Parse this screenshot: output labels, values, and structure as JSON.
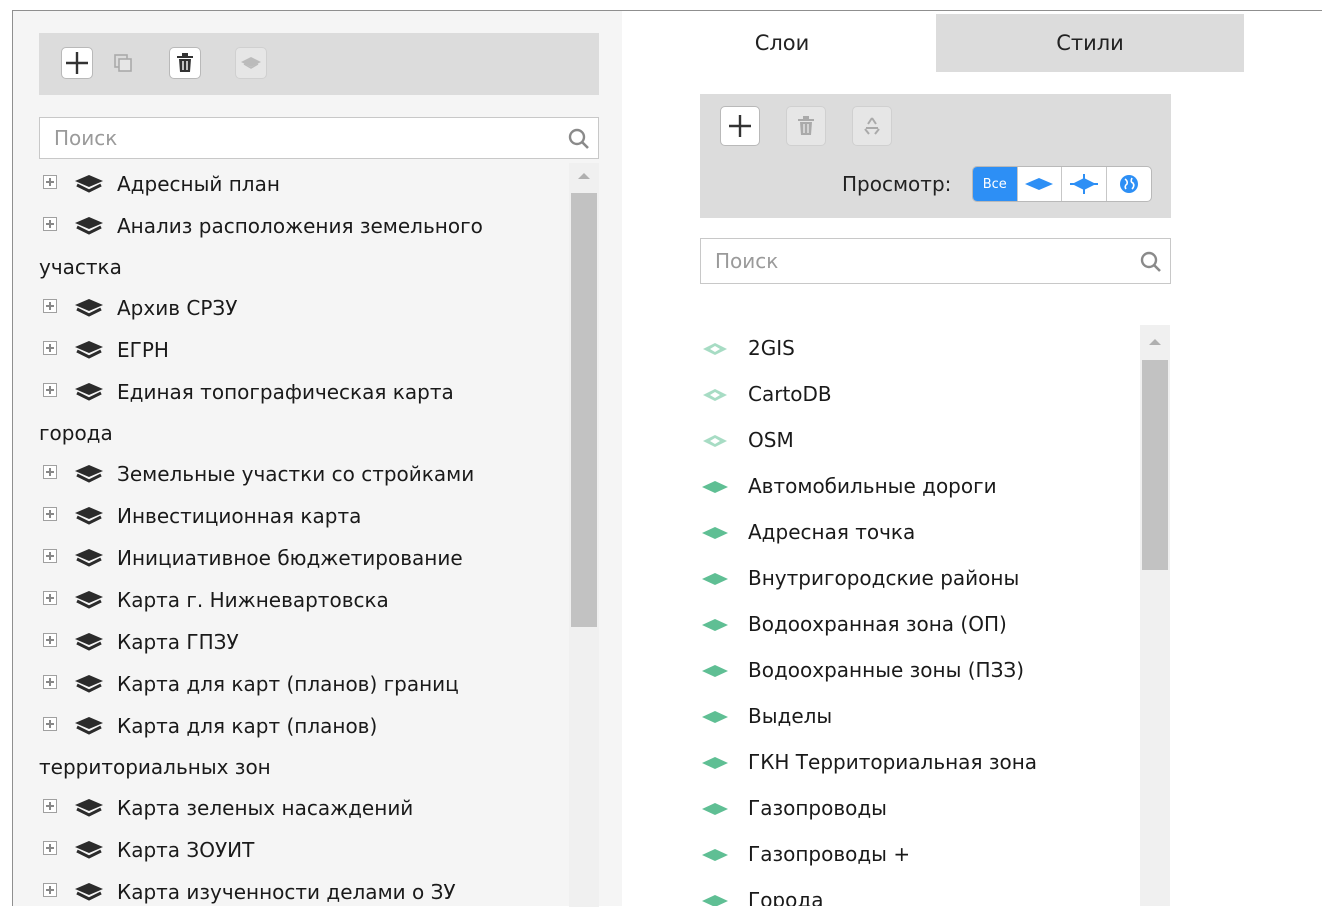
{
  "colors": {
    "accent": "#2d8ff5",
    "layer_green": "#5fbf94",
    "layer_green_dark": "#3f9f77",
    "group_icon": "#2b2b2b",
    "toolbar_bg": "#dcdcdc"
  },
  "left_panel": {
    "toolbar": {
      "icons": [
        "plus-icon",
        "duplicate-icon",
        "trash-icon",
        "layers-icon"
      ]
    },
    "search": {
      "placeholder": "Поиск",
      "icon": "search-icon"
    },
    "tree_items": [
      {
        "label": "Адресный план"
      },
      {
        "label": "Анализ расположения земельного",
        "label_cont": "участка"
      },
      {
        "label": "Архив СРЗУ"
      },
      {
        "label": "ЕГРН"
      },
      {
        "label": "Единая топографическая карта",
        "label_cont": "города"
      },
      {
        "label": "Земельные участки со стройками"
      },
      {
        "label": "Инвестиционная карта"
      },
      {
        "label": "Инициативное бюджетирование"
      },
      {
        "label": "Карта г. Нижневартовска"
      },
      {
        "label": "Карта ГПЗУ"
      },
      {
        "label": "Карта для карт (планов) границ"
      },
      {
        "label": "Карта для карт (планов)",
        "label_cont": "территориальных зон"
      },
      {
        "label": "Карта зеленых насаждений"
      },
      {
        "label": "Карта ЗОУИТ"
      },
      {
        "label": "Карта изученности делами о ЗУ"
      }
    ]
  },
  "right_panel": {
    "tabs": [
      {
        "label": "Слои",
        "active": true
      },
      {
        "label": "Стили",
        "active": false
      }
    ],
    "toolbar": {
      "icons": [
        "plus-icon",
        "trash-icon",
        "recycle-icon"
      ],
      "view_label": "Просмотр:",
      "view_options": [
        {
          "label": "Все",
          "active": true
        },
        {
          "icon": "polygon-layer-icon",
          "active": false
        },
        {
          "icon": "line-layer-icon",
          "active": false
        },
        {
          "icon": "globe-icon",
          "active": false
        }
      ]
    },
    "search": {
      "placeholder": "Поиск",
      "icon": "search-icon"
    },
    "layers": [
      {
        "label": "2GIS",
        "type": "tile"
      },
      {
        "label": "CartoDB",
        "type": "tile"
      },
      {
        "label": "OSM",
        "type": "tile"
      },
      {
        "label": "Автомобильные дороги",
        "type": "vector"
      },
      {
        "label": "Адресная точка",
        "type": "vector"
      },
      {
        "label": "Внутригородские районы",
        "type": "vector"
      },
      {
        "label": "Водоохранная зона (ОП)",
        "type": "vector"
      },
      {
        "label": "Водоохранные зоны (ПЗЗ)",
        "type": "vector"
      },
      {
        "label": "Выделы",
        "type": "vector"
      },
      {
        "label": "ГКН Территориальная зона",
        "type": "vector"
      },
      {
        "label": "Газопроводы",
        "type": "vector"
      },
      {
        "label": "Газопроводы +",
        "type": "vector"
      },
      {
        "label": "Города",
        "type": "vector"
      }
    ]
  }
}
